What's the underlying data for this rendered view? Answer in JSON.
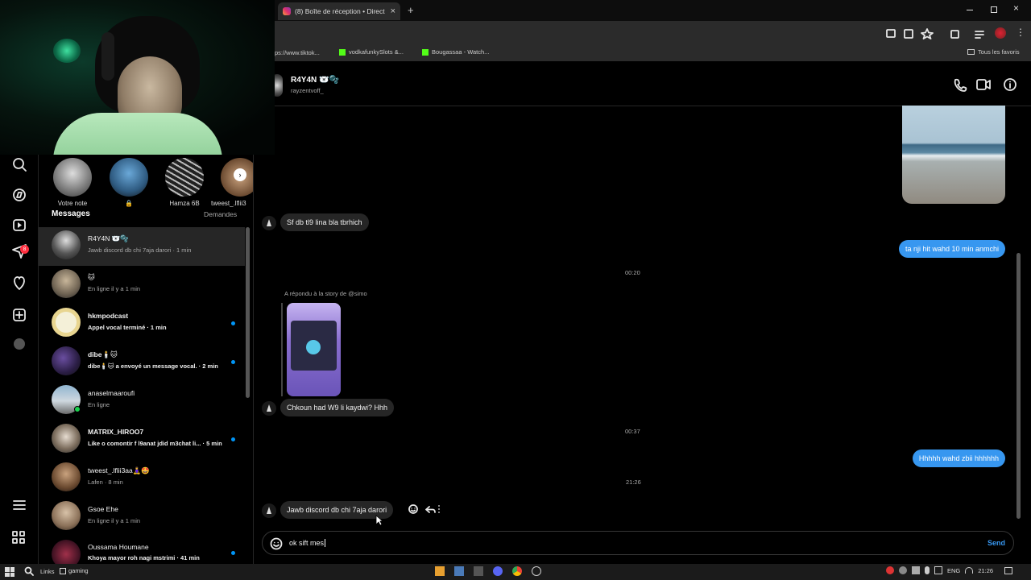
{
  "browser": {
    "tab_title": "(8) Boîte de réception • Direct",
    "new_tab": "+",
    "bookmarks": [
      "ps://www.tiktok...",
      "vodkafunkySlots &...",
      "Bougassaa - Watch..."
    ],
    "all_bookmarks": "Tous les favoris"
  },
  "nav": {
    "notification_badge": "8"
  },
  "stories": [
    {
      "label": "Votre note"
    },
    {
      "label": "🔒"
    },
    {
      "label": "Hamza 6B"
    },
    {
      "label": "tweest_.lflii3"
    }
  ],
  "sidebar": {
    "title": "Messages",
    "requests": "Demandes",
    "conversations": [
      {
        "name": "R4Y4N 🐻‍❄️🫧",
        "preview": "Jawb discord db chi 7aja darori · 1 min",
        "unread": false
      },
      {
        "name": "🐱",
        "preview": "En ligne il y a 1 min",
        "unread": false
      },
      {
        "name": "hkmpodcast",
        "preview": "Appel vocal terminé · 1 min",
        "unread": true
      },
      {
        "name": "dibe🕯️🐱",
        "preview": "dibe🕯️🐱 a envoyé un message vocal. · 2 min",
        "unread": true
      },
      {
        "name": "anaselmaaroufi",
        "preview": "En ligne",
        "unread": false
      },
      {
        "name": "MATRIX_HIROO7",
        "preview": "Like o comontir f l9anat jdid m3chat li... · 5 min",
        "unread": true
      },
      {
        "name": "tweest_.lflii3aa🧘‍♀️🤩",
        "preview": "Lafen · 8 min",
        "unread": false
      },
      {
        "name": "Gsoe Ehe",
        "preview": "En ligne il y a 1 min",
        "unread": false
      },
      {
        "name": "Oussama Houmane",
        "preview": "Khoya mayor roh nagi mstrimi · 41 min",
        "unread": true
      }
    ]
  },
  "chat": {
    "name": "R4Y4N 🐻‍❄️🫧",
    "username": "rayzentvoff_",
    "messages": [
      {
        "type": "in",
        "text": "Sf db tl9 lina bla tbrhich"
      },
      {
        "type": "out",
        "text": "ta nji hit wahd 10 min anmchi"
      },
      {
        "type": "time",
        "text": "00:20"
      },
      {
        "type": "reply_note",
        "text": "A répondu à la story de @simo"
      },
      {
        "type": "in",
        "text": "Chkoun had W9 li kaydwi? Hhh"
      },
      {
        "type": "time",
        "text": "00:37"
      },
      {
        "type": "out",
        "text": "Hhhhh wahd zbii hhhhhh"
      },
      {
        "type": "time",
        "text": "21:26"
      },
      {
        "type": "in",
        "text": "Jawb discord db chi 7aja darori"
      }
    ],
    "composer_value": "ok sift mes",
    "send_label": "Send"
  },
  "taskbar": {
    "links": "Links",
    "folder": "gaming",
    "lang": "ENG",
    "clock": "21:26"
  },
  "colors": {
    "accent": "#3797f0",
    "unread_dot": "#0095f6",
    "incoming_bubble": "#262626"
  }
}
